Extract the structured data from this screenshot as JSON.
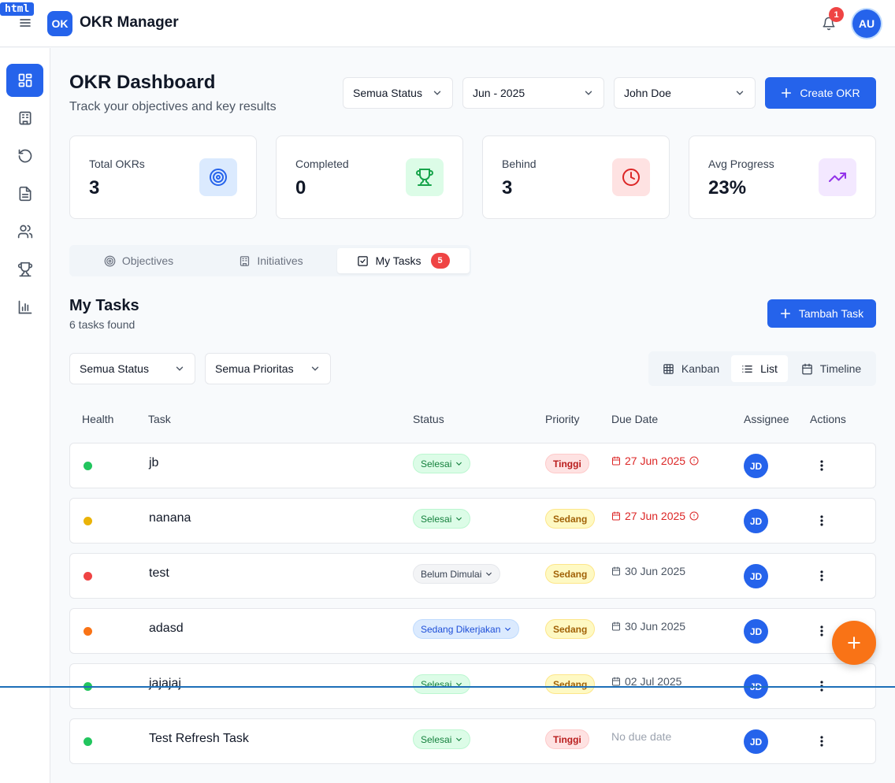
{
  "devtag": "html",
  "app": {
    "logo_text": "OK",
    "title": "OKR Manager",
    "notifications": "1",
    "user_initials": "AU"
  },
  "header": {
    "title": "OKR Dashboard",
    "subtitle": "Track your objectives and key results"
  },
  "filters": {
    "status": "Semua Status",
    "period": "Jun - 2025",
    "owner": "John Doe",
    "create_label": "Create OKR"
  },
  "stats": [
    {
      "label": "Total OKRs",
      "value": "3",
      "icon": "target-icon",
      "bg": "#dbeafe",
      "color": "#2563eb"
    },
    {
      "label": "Completed",
      "value": "0",
      "icon": "trophy-icon",
      "bg": "#dcfce7",
      "color": "#16a34a"
    },
    {
      "label": "Behind",
      "value": "3",
      "icon": "clock-icon",
      "bg": "#fee2e2",
      "color": "#dc2626"
    },
    {
      "label": "Avg Progress",
      "value": "23%",
      "icon": "trending-up-icon",
      "bg": "#f3e8ff",
      "color": "#9333ea"
    }
  ],
  "tabs": [
    {
      "label": "Objectives"
    },
    {
      "label": "Initiatives"
    },
    {
      "label": "My Tasks",
      "badge": "5"
    }
  ],
  "tasks_section": {
    "title": "My Tasks",
    "count": "6 tasks found",
    "add_label": "Tambah Task",
    "status_filter": "Semua Status",
    "priority_filter": "Semua Prioritas",
    "views": [
      "Kanban",
      "List",
      "Timeline"
    ],
    "active_view": "List"
  },
  "table": {
    "headers": [
      "Health",
      "Task",
      "Status",
      "Priority",
      "Due Date",
      "Assignee",
      "Actions"
    ],
    "rows": [
      {
        "health": "#22c55e",
        "task": "jb",
        "status": "Selesai",
        "priority": "Tinggi",
        "due": "27 Jun 2025",
        "due_state": "late",
        "assignee": "JD"
      },
      {
        "health": "#eab308",
        "task": "nanana",
        "status": "Selesai",
        "priority": "Sedang",
        "due": "27 Jun 2025",
        "due_state": "late",
        "assignee": "JD"
      },
      {
        "health": "#ef4444",
        "task": "test",
        "status": "Belum Dimulai",
        "priority": "Sedang",
        "due": "30 Jun 2025",
        "due_state": "ok",
        "assignee": "JD"
      },
      {
        "health": "#f97316",
        "task": "adasd",
        "status": "Sedang Dikerjakan",
        "priority": "Sedang",
        "due": "30 Jun 2025",
        "due_state": "ok",
        "assignee": "JD"
      },
      {
        "health": "#22c55e",
        "task": "jajajaj",
        "status": "Selesai",
        "priority": "Sedang",
        "due": "02 Jul 2025",
        "due_state": "ok",
        "assignee": "JD"
      },
      {
        "health": "#22c55e",
        "task": "Test Refresh Task",
        "status": "Selesai",
        "priority": "Tinggi",
        "due": "No due date",
        "due_state": "none",
        "assignee": "JD"
      }
    ]
  },
  "colors": {
    "primary": "#2563eb",
    "fab": "#f97316",
    "danger": "#ef4444"
  }
}
